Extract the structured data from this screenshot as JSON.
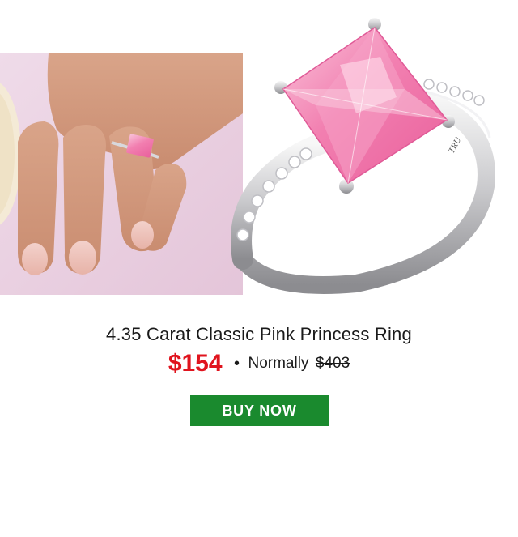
{
  "product": {
    "title": "4.35 Carat Classic Pink Princess Ring",
    "sale_price": "$154",
    "separator": "•",
    "normally_label": "Normally",
    "original_price": "$403",
    "ring_engraving": "TRU"
  },
  "cta": {
    "label": "BUY NOW"
  },
  "colors": {
    "sale_price": "#e0141e",
    "button_bg": "#1a8a2e",
    "button_text": "#ffffff",
    "gem_pink": "#f48bb6",
    "background_pink": "#ecd3e4"
  }
}
